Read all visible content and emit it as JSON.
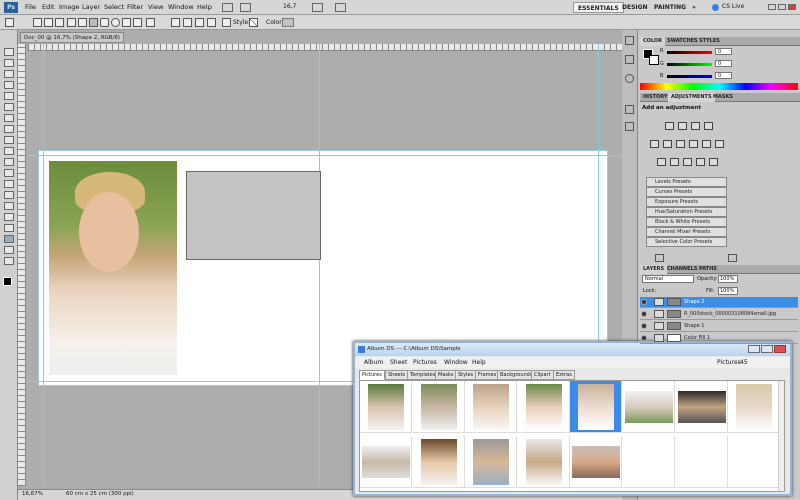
{
  "app": {
    "logo": "Ps"
  },
  "menu": [
    "File",
    "Edit",
    "Image",
    "Layer",
    "Select",
    "Filter",
    "View",
    "Window",
    "Help"
  ],
  "zoom_combo": "16,7",
  "workspace": {
    "essentials": "ESSENTIALS",
    "design": "DESIGN",
    "painting": "PAINTING",
    "more": "»",
    "cslive": "CS Live"
  },
  "options": {
    "style_label": "Style:",
    "color_label": "Color:"
  },
  "document": {
    "tab": "Doc_00 @ 16,7% (Shape 2, RGB/8) *"
  },
  "status": {
    "zoom": "16,67%",
    "size": "60 cm x 25 cm (300 ppi)"
  },
  "color_panel": {
    "tabs": [
      "COLOR",
      "SWATCHES",
      "STYLES"
    ],
    "labels": [
      "R",
      "G",
      "B"
    ],
    "values": [
      "0",
      "0",
      "0"
    ],
    "colors": {
      "r": "#d23030",
      "g": "#30b030",
      "b": "#3050d0"
    }
  },
  "adjust_panel": {
    "tabs": [
      "HISTORY",
      "ADJUSTMENTS",
      "MASKS"
    ],
    "heading": "Add an adjustment",
    "presets": [
      "Levels Presets",
      "Curves Presets",
      "Exposure Presets",
      "Hue/Saturation Presets",
      "Black & White Presets",
      "Channel Mixer Presets",
      "Selective Color Presets"
    ]
  },
  "layers_panel": {
    "tabs": [
      "LAYERS",
      "CHANNELS",
      "PATHS"
    ],
    "blend": "Normal",
    "opacity_label": "Opacity:",
    "opacity": "100%",
    "lock_label": "Lock:",
    "fill_label": "Fill:",
    "fill": "100%",
    "layers": [
      "Shape 2",
      "R_000stock_000003108084small.jpg",
      "Shape 1",
      "Color Fill 1"
    ]
  },
  "album": {
    "title": "Album DS  ---  C:\\Album DS\\Sample",
    "menu": [
      "Album",
      "Sheet",
      "Pictures",
      "Window",
      "Help"
    ],
    "pictures_label": "Pictures",
    "pictures_count": "45",
    "tabs": [
      "Pictures",
      "Sheets",
      "Templates",
      "Masks",
      "Styles",
      "Frames",
      "Backgrounds",
      "Clipart",
      "Extras"
    ]
  }
}
